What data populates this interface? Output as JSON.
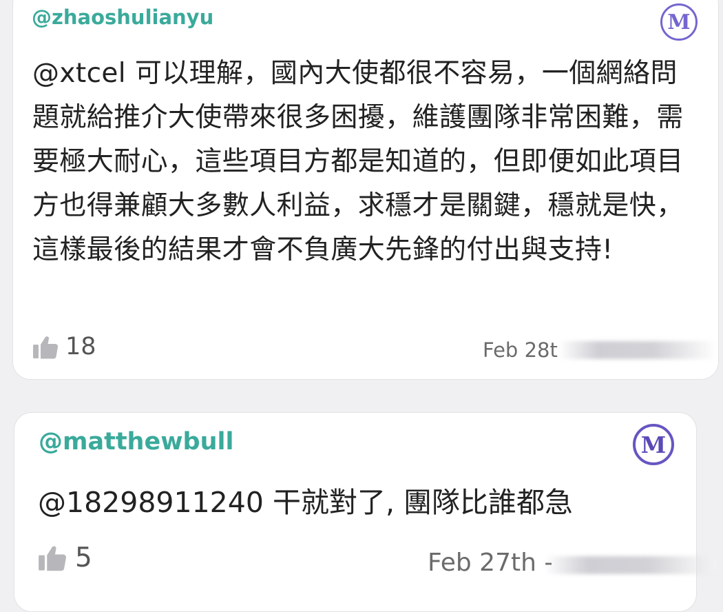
{
  "comments": [
    {
      "username": "@zhaoshulianyu",
      "badge_letter": "M",
      "text": "@xtcel 可以理解，國內大使都很不容易，一個網絡問題就給推介大使帶來很多困擾，維護團隊非常困難，需要極大耐心，這些項目方都是知道的，但即便如此項目方也得兼顧大多數人利益，求穩才是關鍵，穩就是快，這樣最後的結果才會不負廣大先鋒的付出與支持!",
      "like_icon": "thumbs-up-icon",
      "like_count": "18",
      "timestamp": "Feb 28th"
    },
    {
      "username": "@matthewbull",
      "badge_letter": "M",
      "text": "@18298911240 干就對了, 團隊比誰都急",
      "like_icon": "thumbs-up-icon",
      "like_count": "5",
      "timestamp": "Feb 27th -"
    }
  ],
  "colors": {
    "username": "#3aaa9b",
    "badge": "#7466cf",
    "text": "#222222",
    "meta": "#6b6b6b",
    "background": "#f0f0f2"
  }
}
